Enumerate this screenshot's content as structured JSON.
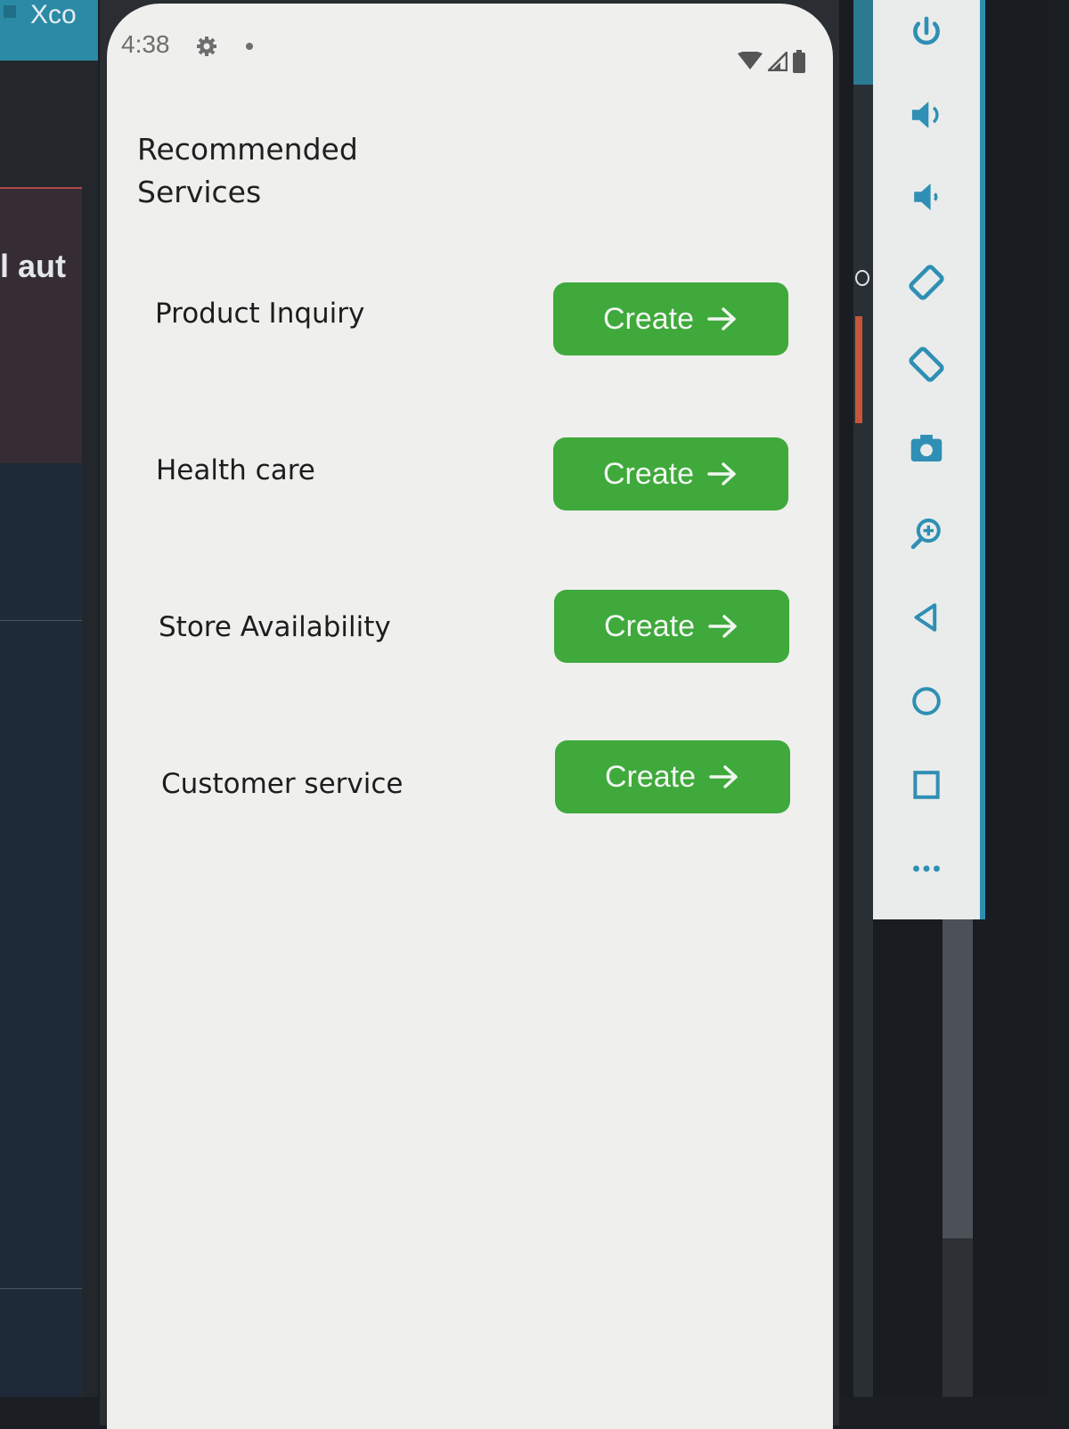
{
  "host": {
    "ide_title": "Xco",
    "ide_side_text": "l aut"
  },
  "status_bar": {
    "time": "4:38"
  },
  "page": {
    "section_title": "Recommended Services"
  },
  "services": [
    {
      "label": "Product Inquiry",
      "button": "Create"
    },
    {
      "label": "Health care",
      "button": "Create"
    },
    {
      "label": "Store Availability",
      "button": "Create"
    },
    {
      "label": "Customer service",
      "button": "Create"
    }
  ],
  "emulator_toolbar": {
    "icons": [
      "power-icon",
      "volume-up-icon",
      "volume-down-icon",
      "rotate-left-icon",
      "rotate-right-icon",
      "camera-icon",
      "zoom-icon",
      "back-icon",
      "home-icon",
      "overview-icon",
      "more-icon"
    ]
  },
  "colors": {
    "button_green": "#3fa93c",
    "screen_bg": "#efefed",
    "toolbar_icon": "#2f8fb4"
  }
}
